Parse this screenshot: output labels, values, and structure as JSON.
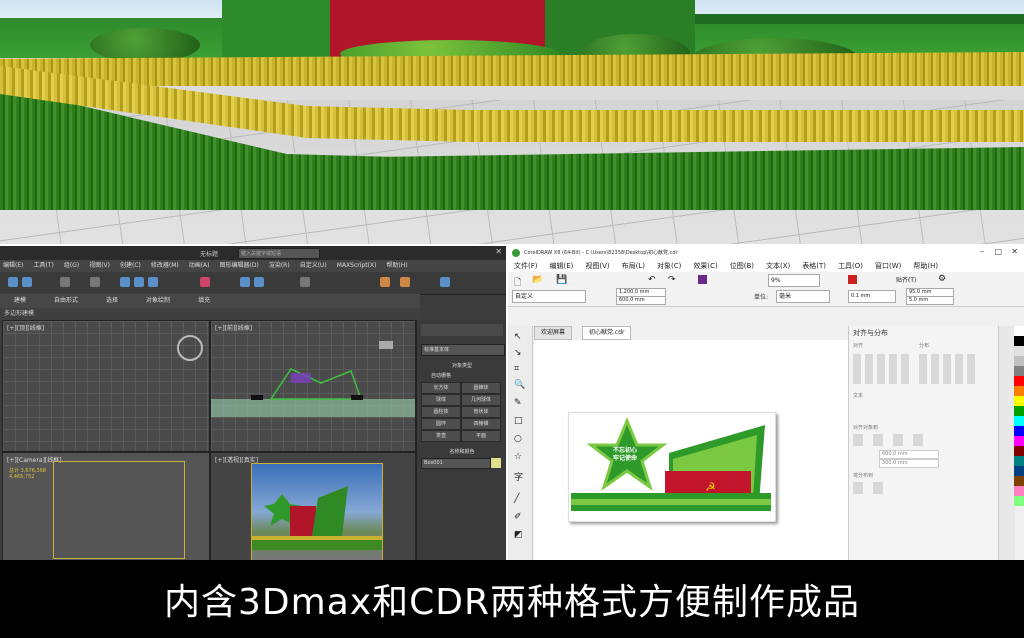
{
  "max_window": {
    "title": "无标题",
    "search_placeholder": "键入关键字或短语",
    "menu": [
      "编辑(E)",
      "工具(T)",
      "组(G)",
      "视图(V)",
      "创建(C)",
      "修改器(M)",
      "动画(A)",
      "图形编辑器(D)",
      "渲染(R)",
      "自定义(U)",
      "MAXScript(X)",
      "帮助(H)"
    ],
    "ribbon": [
      "建模",
      "自由形式",
      "选择",
      "对象绘制",
      "填充"
    ],
    "ribbon_sub": "多边形建模",
    "viewports": [
      "[+][顶][线框]",
      "[+][前][线框]",
      "[+][Camera][线框]",
      "[+][透视][真实]"
    ],
    "camera_stats": {
      "label1": "总计",
      "value1": "3,676,368",
      "label2": "",
      "value2": "4,465,752"
    },
    "command_panel": {
      "dropdown": "标准基本体",
      "section": "对象类型",
      "autogrid": "自动栅格",
      "buttons": [
        "长方体",
        "圆锥体",
        "球体",
        "几何球体",
        "圆柱体",
        "管状体",
        "圆环",
        "四棱锥",
        "茶壶",
        "平面"
      ],
      "name_section": "名称和颜色",
      "name_value": "Box001"
    }
  },
  "cdr_window": {
    "title": "CorelDRAW X8 (64-Bit) - C:\\Users\\82358\\Desktop\\初心献党.cdr",
    "menu": [
      "文件(F)",
      "编辑(E)",
      "视图(V)",
      "布局(L)",
      "对象(C)",
      "效果(C)",
      "位图(B)",
      "文本(X)",
      "表格(T)",
      "工具(O)",
      "窗口(W)",
      "帮助(H)"
    ],
    "zoom": "9%",
    "snap_label": "贴齐(T)",
    "preset": "自定义",
    "width": "1,200.0 mm",
    "height": "600.0 mm",
    "unit_label": "单位:",
    "unit": "毫米",
    "nudge": "0.1 mm",
    "dup_x": "95.0 mm",
    "dup_y": "5.0 mm",
    "tabs": [
      "欢迎屏幕",
      "初心献党.cdr"
    ],
    "badge_text": [
      "不忘初心",
      "牢记使命"
    ],
    "panel_title": "对齐与分布",
    "panel_sections": [
      "对齐",
      "分布",
      "文本",
      "对齐对象到",
      "将分布到"
    ],
    "panel_x": "600.0 mm",
    "panel_y": "300.0 mm",
    "palette": [
      "#ffffff",
      "#000000",
      "#e0e0e0",
      "#c0c0c0",
      "#808080",
      "#ff0000",
      "#ff8000",
      "#ffff00",
      "#00a000",
      "#00ffff",
      "#0000ff",
      "#ff00ff",
      "#800000",
      "#008080",
      "#004080",
      "#804000",
      "#ff80c0",
      "#80ff80"
    ]
  },
  "caption": "内含3Dmax和CDR两种格式方便制作成品"
}
